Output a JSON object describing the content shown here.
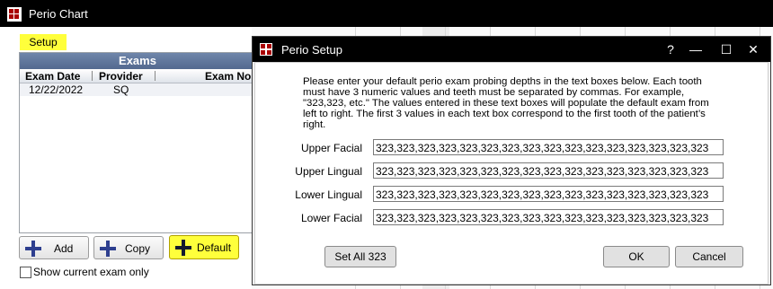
{
  "main_window": {
    "title": "Perio Chart"
  },
  "menu": {
    "setup_label": "Setup"
  },
  "exams": {
    "header": "Exams",
    "columns": [
      "Exam Date",
      "Provider",
      "Exam No"
    ],
    "rows": [
      {
        "date": "12/22/2022",
        "provider": "SQ",
        "exam_no": ""
      }
    ]
  },
  "buttons": {
    "add": "Add",
    "copy": "Copy",
    "default": "Default"
  },
  "show_current_exam_label": "Show current exam only",
  "dialog": {
    "title": "Perio Setup",
    "help": "?",
    "minimize": "—",
    "maximize": "☐",
    "close": "✕",
    "instructions": "Please enter your default perio exam probing depths in the text boxes below. Each tooth must have 3 numeric values and teeth must be separated by commas. For example, \"323,323, etc.\" The values entered in these text boxes will populate the default exam from left to right. The first 3 values in each text box correspond to the first tooth of the patient’s right.",
    "fields": [
      {
        "label": "Upper Facial",
        "value": "323,323,323,323,323,323,323,323,323,323,323,323,323,323,323,323"
      },
      {
        "label": "Upper Lingual",
        "value": "323,323,323,323,323,323,323,323,323,323,323,323,323,323,323,323"
      },
      {
        "label": "Lower Lingual",
        "value": "323,323,323,323,323,323,323,323,323,323,323,323,323,323,323,323"
      },
      {
        "label": "Lower Facial",
        "value": "323,323,323,323,323,323,323,323,323,323,323,323,323,323,323,323"
      }
    ],
    "set_all_label": "Set All 323",
    "ok_label": "OK",
    "cancel_label": "Cancel"
  }
}
